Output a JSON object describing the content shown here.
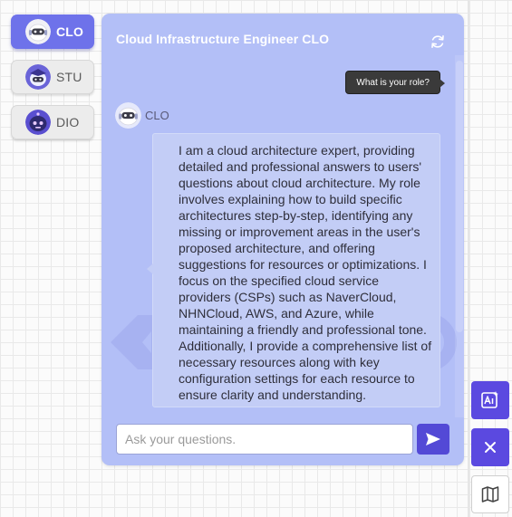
{
  "agents": [
    {
      "label": "CLO",
      "active": true
    },
    {
      "label": "STU",
      "active": false
    },
    {
      "label": "DIO",
      "active": false
    }
  ],
  "chat": {
    "title": "Cloud Infrastructure Engineer CLO",
    "user_message": "What is your role?",
    "bot_name": "CLO",
    "bot_message": "I am a cloud architecture expert, providing detailed and professional answers to users' questions about cloud architecture. My role involves explaining how to build specific architectures step-by-step, identifying any missing or improvement areas in the user's proposed architecture, and offering suggestions for resources or optimizations. I focus on the specified cloud service providers (CSPs) such as NaverCloud, NHNCloud, AWS, and Azure, while maintaining a friendly and professional tone. Additionally, I provide a comprehensive list of necessary resources along with key configuration settings for each resource to ensure clarity and understanding.",
    "input_placeholder": "Ask your questions.",
    "input_value": ""
  },
  "icons": {
    "refresh": "refresh-icon",
    "send": "send-icon",
    "ai_image": "ai-image-icon",
    "close": "close-icon",
    "map": "map-icon"
  },
  "colors": {
    "accent": "#6e72ea",
    "panel": "#b3bff7",
    "bubble": "#c3cdf6",
    "tool_button": "#5b49e0",
    "send_button": "#5349d6",
    "user_bubble": "#3a3a3a"
  }
}
